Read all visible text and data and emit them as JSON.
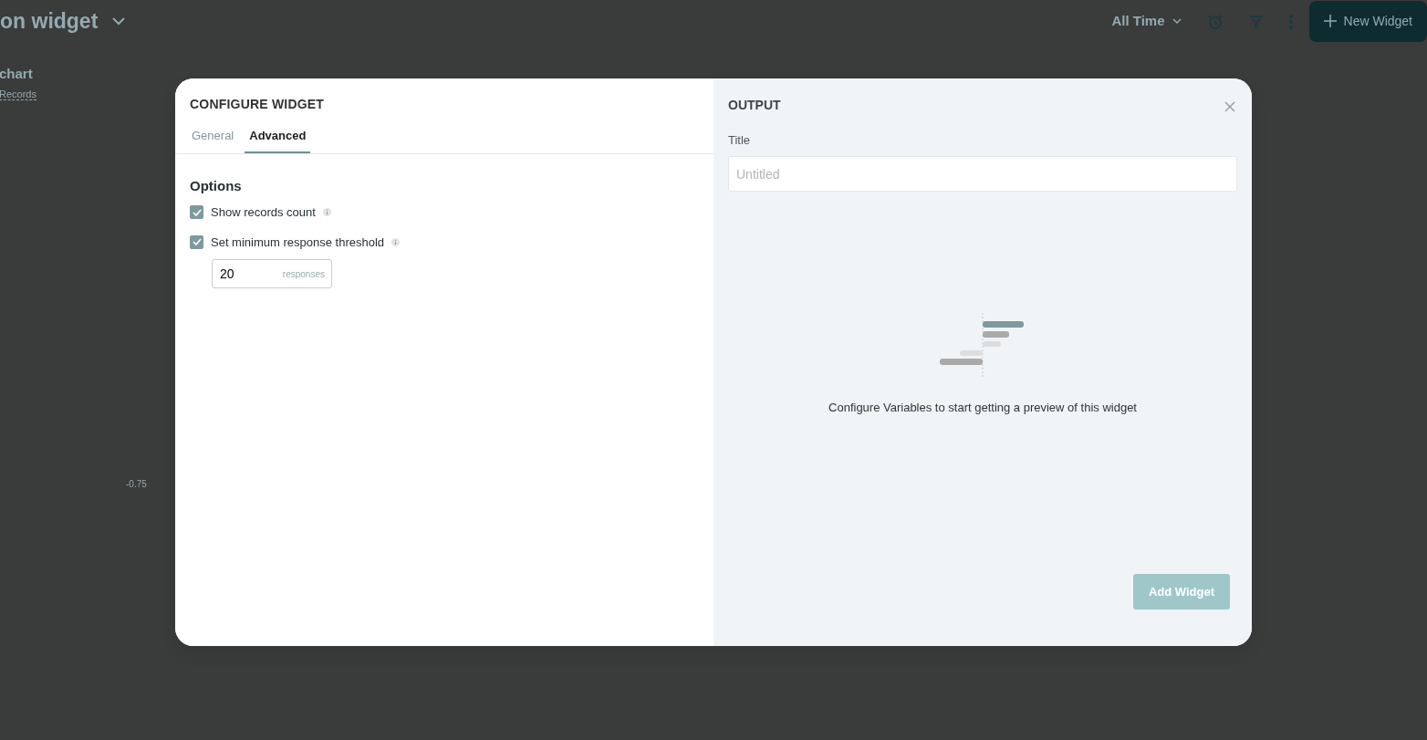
{
  "page": {
    "title": "on widget",
    "range": "All Time",
    "new_widget": "New Widget",
    "chart_title": "chart",
    "records_link": "Records",
    "axis_label": "-0.75"
  },
  "dialog": {
    "title": "CONFIGURE WIDGET",
    "tabs": [
      {
        "label": "General",
        "selected": false
      },
      {
        "label": "Advanced",
        "selected": true
      }
    ],
    "section": "Options",
    "options": [
      {
        "label": "Show records count",
        "checked": true
      },
      {
        "label": "Set minimum response threshold",
        "checked": true
      }
    ],
    "threshold": {
      "value": "20",
      "unit": "responses"
    }
  },
  "output": {
    "title": "OUTPUT",
    "field_label": "Title",
    "placeholder": "Untitled",
    "message": "Configure Variables to start getting a preview of this widget",
    "button": "Add Widget",
    "button_disabled": true
  }
}
